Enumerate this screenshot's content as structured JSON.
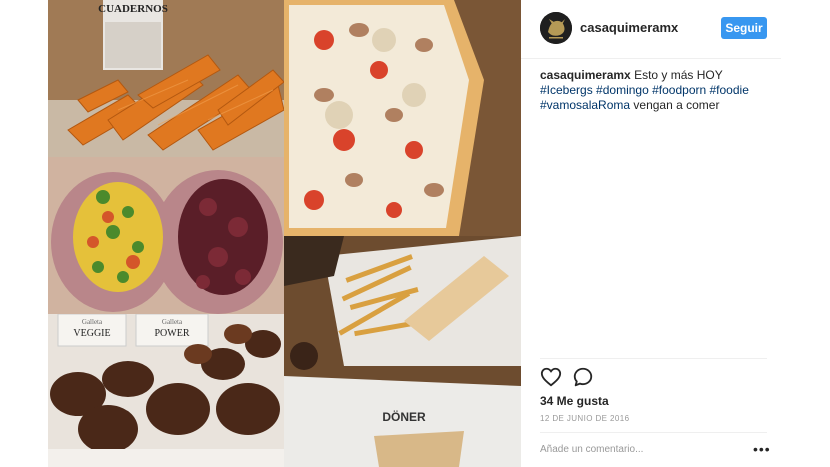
{
  "post": {
    "username": "casaquimeramx",
    "follow_label": "Seguir",
    "caption": {
      "username": "casaquimeramx",
      "text_before": "Esto y más HOY",
      "tag1": "#Icebergs",
      "tag2": "#domingo",
      "tag3": "#foodporn",
      "tag4": "#foodie",
      "tag5": "#vamosalaRoma",
      "text_after": "vengan a comer"
    },
    "likes": "34 Me gusta",
    "date": "12 DE JUNIO DE 2016",
    "comment_placeholder": "Añade un comentario...",
    "more_label": "•••"
  },
  "image_text": {
    "bottle_label": "CUADERNOS",
    "card1_line1": "Galleta",
    "card1_line2": "VEGGIE",
    "card2_line1": "Galleta",
    "card2_line2": "POWER",
    "wrap_text": "DÖNER"
  },
  "icons": {
    "like": "heart-outline-icon",
    "comment": "speech-bubble-icon",
    "more": "ellipsis-icon"
  },
  "colors": {
    "follow_button": "#3897f0",
    "hashtag": "#003569",
    "muted": "#999999",
    "text": "#262626"
  }
}
